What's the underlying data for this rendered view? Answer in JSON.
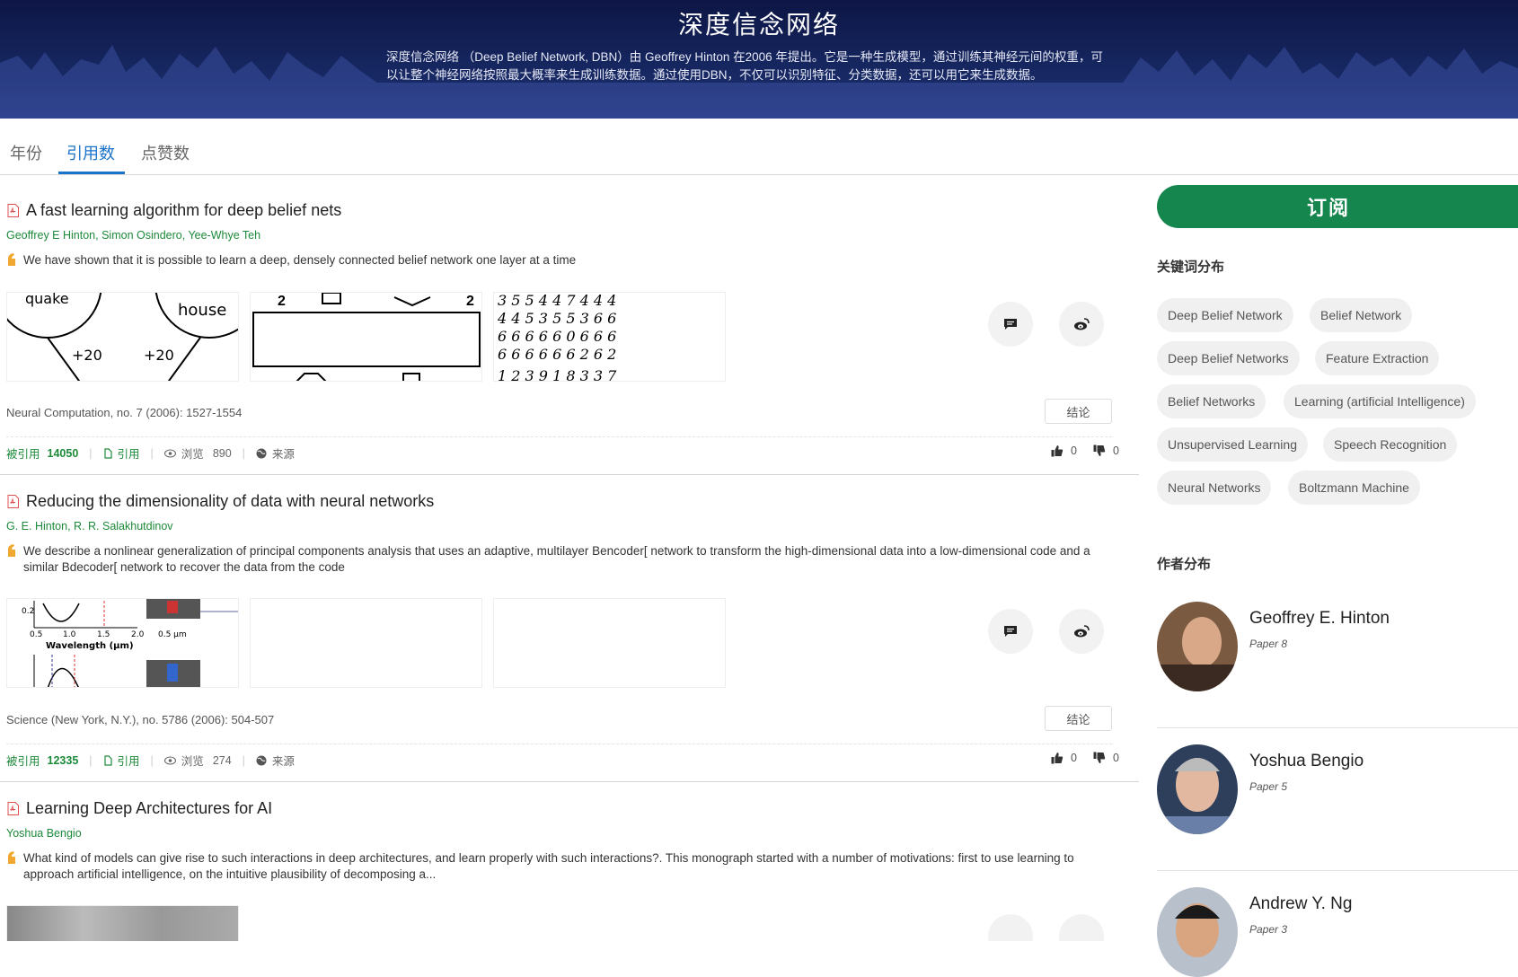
{
  "hero": {
    "title": "深度信念网络",
    "description": "深度信念网络 （Deep Belief Network, DBN）由 Geoffrey Hinton 在2006 年提出。它是一种生成模型，通过训练其神经元间的权重，可以让整个神经网络按照最大概率来生成训练数据。通过使用DBN，不仅可以识别特征、分类数据，还可以用它来生成数据。"
  },
  "tabs": [
    {
      "label": "年份",
      "active": false
    },
    {
      "label": "引用数",
      "active": true
    },
    {
      "label": "点赞数",
      "active": false
    }
  ],
  "papers": [
    {
      "title": "A fast learning algorithm for deep belief nets",
      "authors": [
        "Geoffrey E Hinton",
        "Simon Osindero",
        "Yee-Whye Teh"
      ],
      "abstract": "We have shown that it is possible to learn a deep, densely connected belief network one layer at a time",
      "thumb_labels": [
        "quake",
        "house",
        "+20",
        "+20"
      ],
      "venue": "Neural Computation, no. 7 (2006): 1527-1554",
      "conclusion_label": "结论",
      "cited_label": "被引用",
      "cited_count": "14050",
      "cite_label": "引用",
      "views_label": "浏览",
      "views": "890",
      "source_label": "来源",
      "likes": "0",
      "dislikes": "0"
    },
    {
      "title": "Reducing the dimensionality of data with neural networks",
      "authors": [
        "G. E. Hinton",
        "R. R. Salakhutdinov"
      ],
      "abstract": "We describe a nonlinear generalization of principal components analysis that uses an adaptive, multilayer Bencoder[ network to transform the high-dimensional data into a low-dimensional code and a similar Bdecoder[ network to recover the data from the code",
      "thumb_labels": [
        "0.2",
        "0.5",
        "1.0",
        "1.5",
        "2.0",
        "Wavelength (μm)",
        "0.5 μm"
      ],
      "venue": "Science (New York, N.Y.), no. 5786 (2006): 504-507",
      "conclusion_label": "结论",
      "cited_label": "被引用",
      "cited_count": "12335",
      "cite_label": "引用",
      "views_label": "浏览",
      "views": "274",
      "source_label": "来源",
      "likes": "0",
      "dislikes": "0"
    },
    {
      "title": "Learning Deep Architectures for AI",
      "authors": [
        "Yoshua Bengio"
      ],
      "abstract": "What kind of models can give rise to such interactions in deep architectures, and learn properly with such interactions?. This monograph started with a number of motivations: first to use learning to approach artificial intelligence, on the intuitive plausibility of decomposing a..."
    }
  ],
  "sidebar": {
    "subscribe_label": "订阅",
    "keywords_heading": "关键词分布",
    "keywords": [
      "Deep Belief Network",
      "Belief Network",
      "Deep Belief Networks",
      "Feature Extraction",
      "Belief Networks",
      "Learning (artificial Intelligence)",
      "Unsupervised Learning",
      "Speech Recognition",
      "Neural Networks",
      "Boltzmann Machine"
    ],
    "authors_heading": "作者分布",
    "authors": [
      {
        "name": "Geoffrey E. Hinton",
        "papers": "Paper 8"
      },
      {
        "name": "Yoshua Bengio",
        "papers": "Paper 5"
      },
      {
        "name": "Andrew Y. Ng",
        "papers": "Paper 3"
      }
    ]
  },
  "colors": {
    "accent": "#1a73c9",
    "green": "#15864d",
    "author_green": "#1d8a3a",
    "hero_bg": "#101a4e"
  }
}
